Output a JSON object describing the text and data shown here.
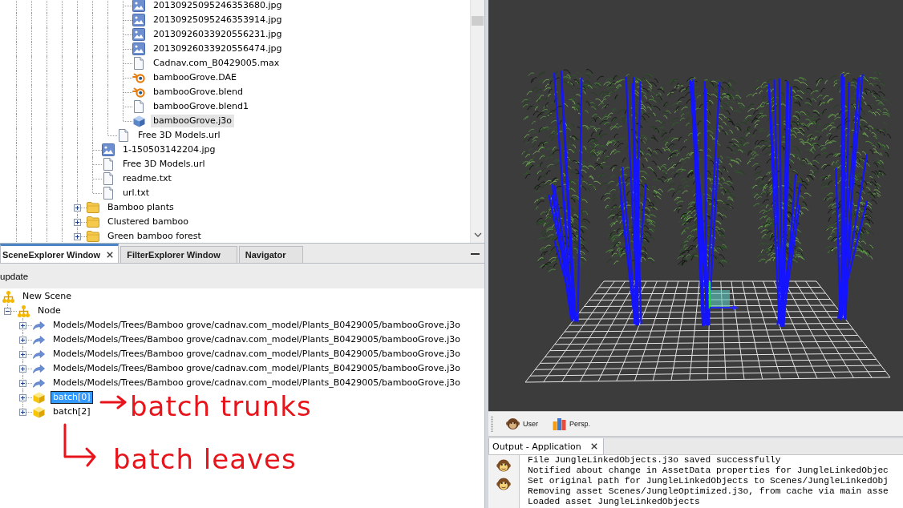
{
  "file_tree": {
    "items": [
      {
        "children": [
          {
            "children": [
              {
                "children": [
                  {
                    "label": "20130925095246353680.jpg",
                    "kind": "image",
                    "selected": false
                  },
                  {
                    "label": "20130925095246353914.jpg",
                    "kind": "image",
                    "selected": false
                  },
                  {
                    "label": "20130926033920556231.jpg",
                    "kind": "image",
                    "selected": false
                  },
                  {
                    "label": "20130926033920556474.jpg",
                    "kind": "image",
                    "selected": false
                  },
                  {
                    "label": "Cadnav.com_B0429005.max",
                    "kind": "document",
                    "selected": false
                  },
                  {
                    "label": "bambooGrove.DAE",
                    "kind": "blender",
                    "selected": false
                  },
                  {
                    "label": "bambooGrove.blend",
                    "kind": "blender",
                    "selected": false
                  },
                  {
                    "label": "bambooGrove.blend1",
                    "kind": "document",
                    "selected": false
                  },
                  {
                    "label": "bambooGrove.j3o",
                    "kind": "model",
                    "selected": true
                  }
                ]
              },
              {
                "label": "Free 3D Models.url",
                "kind": "document",
                "selected": false
              }
            ]
          },
          {
            "label": "1-150503142204.jpg",
            "kind": "image",
            "selected": false
          },
          {
            "label": "Free 3D Models.url",
            "kind": "document",
            "selected": false
          },
          {
            "label": "readme.txt",
            "kind": "document",
            "selected": false
          },
          {
            "label": "url.txt",
            "kind": "document",
            "selected": false
          }
        ]
      },
      {
        "label": "Bamboo plants",
        "kind": "folder",
        "expanded": false,
        "selected": false
      },
      {
        "label": "Clustered bamboo",
        "kind": "folder",
        "expanded": false,
        "selected": false
      },
      {
        "label": "Green bamboo forest",
        "kind": "folder",
        "expanded": false,
        "selected": false
      }
    ]
  },
  "scene_explorer": {
    "tabs": [
      {
        "label": "SceneExplorer Window",
        "selected": true
      },
      {
        "label": "FilterExplorer Window",
        "selected": false
      },
      {
        "label": "Navigator",
        "selected": false
      }
    ],
    "toolbar_buttons": [
      "update"
    ],
    "tree": [
      {
        "label": "New Scene",
        "kind": "node",
        "selected": false,
        "children": [
          {
            "label": "Node",
            "kind": "node",
            "expanded": true,
            "selected": false,
            "children": [
              {
                "label": "Models/Models/Trees/Bamboo grove/cadnav.com_model/Plants_B0429005/bambooGrove.j3o",
                "kind": "link",
                "expanded": false,
                "selected": false
              },
              {
                "label": "Models/Models/Trees/Bamboo grove/cadnav.com_model/Plants_B0429005/bambooGrove.j3o",
                "kind": "link",
                "expanded": false,
                "selected": false
              },
              {
                "label": "Models/Models/Trees/Bamboo grove/cadnav.com_model/Plants_B0429005/bambooGrove.j3o",
                "kind": "link",
                "expanded": false,
                "selected": false
              },
              {
                "label": "Models/Models/Trees/Bamboo grove/cadnav.com_model/Plants_B0429005/bambooGrove.j3o",
                "kind": "link",
                "expanded": false,
                "selected": false
              },
              {
                "label": "Models/Models/Trees/Bamboo grove/cadnav.com_model/Plants_B0429005/bambooGrove.j3o",
                "kind": "link",
                "expanded": false,
                "selected": false
              },
              {
                "label": "batch[0]",
                "kind": "geometry",
                "expanded": false,
                "selected": true
              },
              {
                "label": "batch[2]",
                "kind": "geometry",
                "expanded": false,
                "selected": false
              }
            ]
          }
        ]
      }
    ],
    "annotations": [
      {
        "text": "batch trunks",
        "kind": "arrow"
      },
      {
        "text": "batch leaves",
        "kind": "elbow"
      }
    ]
  },
  "viewport": {
    "toolbar": [
      {
        "label": "User",
        "kind": "camera"
      },
      {
        "label": "Persp.",
        "kind": "projection"
      }
    ]
  },
  "output_window": {
    "tabs": [
      {
        "label": "Output - Application",
        "selected": true
      }
    ],
    "lines": [
      "File JungleLinkedObjects.j3o saved successfully",
      "Notified about change in AssetData properties for JungleLinkedObjec",
      "Set original path for JungleLinkedObjects to Scenes/JungleLinkedObj",
      "Removing asset Scenes/JungleOptimized.j3o, from cache via main asse",
      "Loaded asset JungleLinkedObjects"
    ]
  }
}
